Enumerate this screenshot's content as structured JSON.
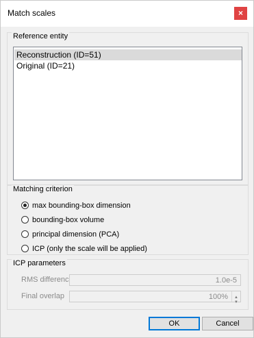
{
  "window": {
    "title": "Match scales",
    "close_glyph": "×"
  },
  "reference": {
    "group_title": "Reference entity",
    "items": [
      {
        "label": "Reconstruction (ID=51)",
        "selected": true
      },
      {
        "label": "Original (ID=21)",
        "selected": false
      }
    ]
  },
  "matching": {
    "group_title": "Matching criterion",
    "options": [
      {
        "label": "max bounding-box dimension",
        "checked": true
      },
      {
        "label": "bounding-box volume",
        "checked": false
      },
      {
        "label": "principal dimension (PCA)",
        "checked": false
      },
      {
        "label": "ICP (only the scale will be applied)",
        "checked": false
      }
    ]
  },
  "icp": {
    "group_title": "ICP parameters",
    "rms_label": "RMS difference",
    "rms_value": "1.0e-5",
    "overlap_label": "Final overlap",
    "overlap_value": "100%",
    "enabled": false
  },
  "buttons": {
    "ok": "OK",
    "cancel": "Cancel"
  }
}
